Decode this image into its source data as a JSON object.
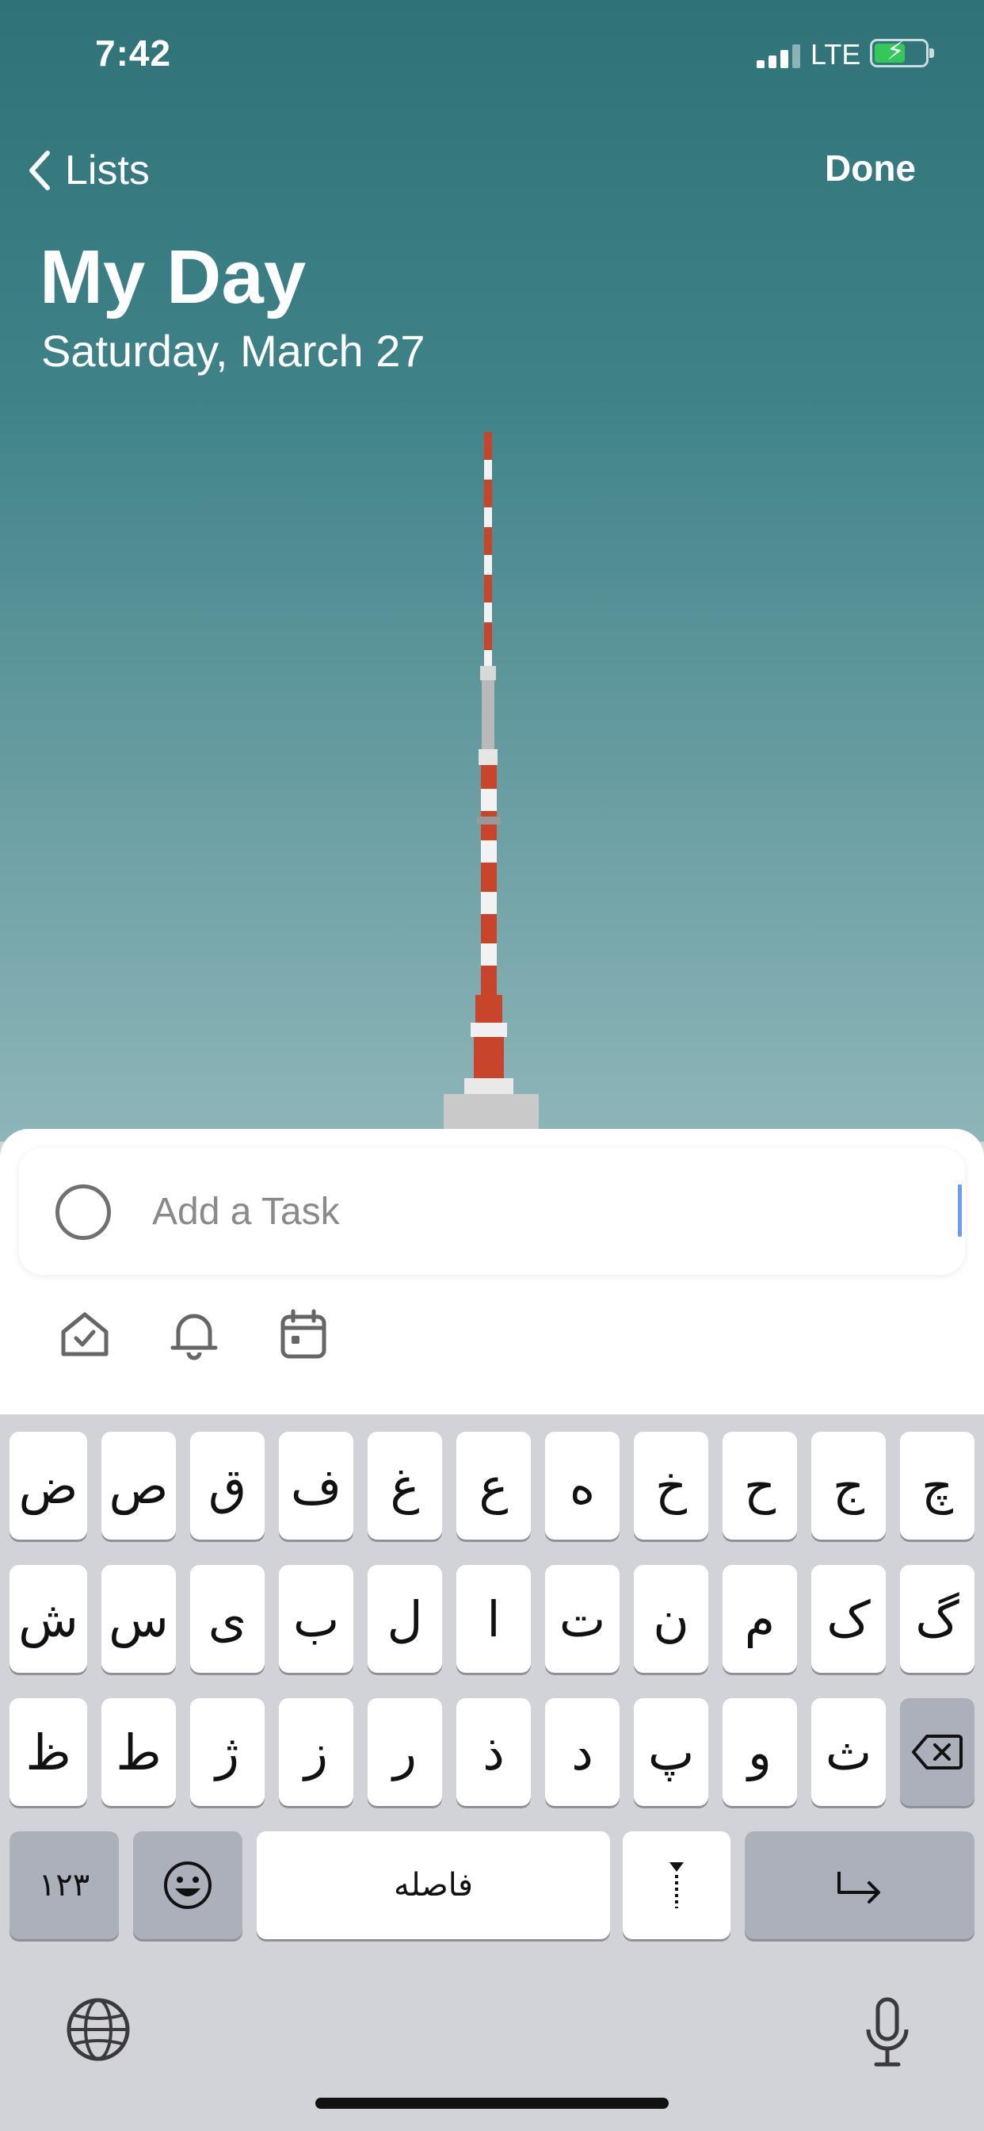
{
  "status_bar": {
    "time": "7:42",
    "network": "LTE"
  },
  "nav": {
    "back_label": "Lists",
    "done_label": "Done"
  },
  "header": {
    "title": "My Day",
    "date": "Saturday, March 27"
  },
  "task_entry": {
    "placeholder": "Add a Task",
    "value": ""
  },
  "task_tools": [
    {
      "icon": "my-day-home-icon"
    },
    {
      "icon": "reminder-bell-icon"
    },
    {
      "icon": "due-date-calendar-icon"
    }
  ],
  "keyboard": {
    "row1": [
      "ض",
      "ص",
      "ق",
      "ف",
      "غ",
      "ع",
      "ه",
      "خ",
      "ح",
      "ج",
      "چ"
    ],
    "row2": [
      "ش",
      "س",
      "ی",
      "ب",
      "ل",
      "ا",
      "ت",
      "ن",
      "م",
      "ک",
      "گ"
    ],
    "row3": [
      "ظ",
      "ط",
      "ژ",
      "ز",
      "ر",
      "ذ",
      "د",
      "پ",
      "و",
      "ث"
    ],
    "numbers_label": "۱۲۳",
    "space_label": "فاصله",
    "icons": {
      "delete": "backspace-icon",
      "emoji": "emoji-icon",
      "zwnj": "zwnj-icon",
      "return": "return-icon",
      "globe": "globe-icon",
      "mic": "microphone-icon"
    }
  },
  "colors": {
    "sky_top": "#2f7278",
    "sky_bottom": "#8eb6b9",
    "tower_red": "#c8452c",
    "caret": "#2f6df6",
    "battery_green": "#34c759"
  }
}
